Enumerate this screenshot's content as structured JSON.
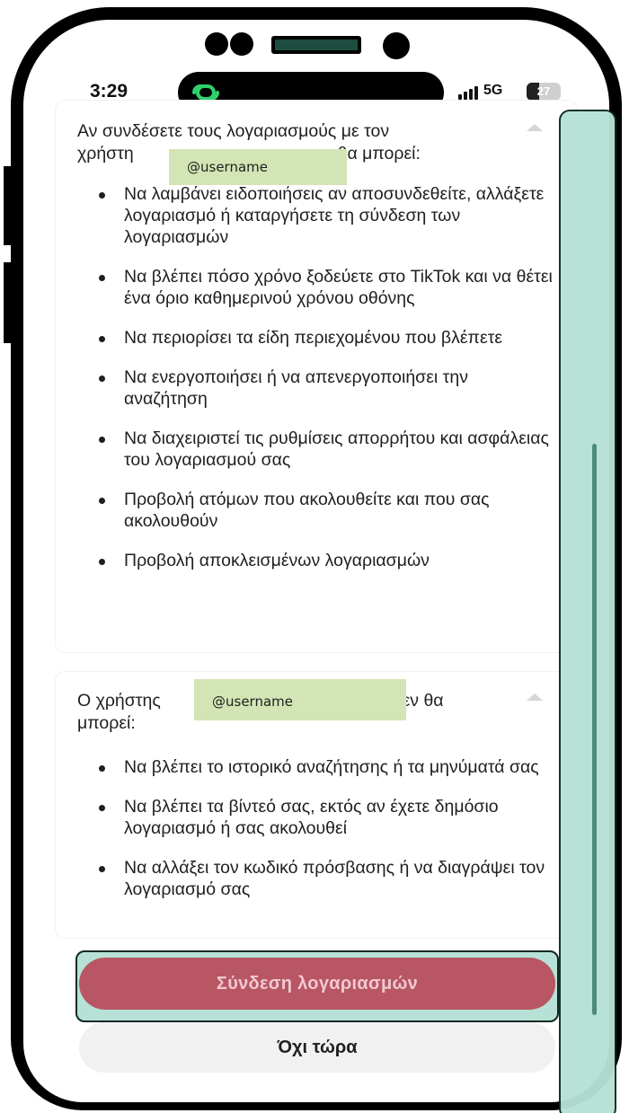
{
  "status_bar": {
    "time": "3:29",
    "network": "5G",
    "battery": "27",
    "app_icon": "link-logo-icon"
  },
  "card_permissions": {
    "intro_before": "Αν συνδέσετε τους λογαριασμούς με τον",
    "intro_line2_start": "χρήστη",
    "intro_line2_end": ", θα μπορεί:",
    "username_label": "@username",
    "items": [
      "Να λαμβάνει ειδοποιήσεις αν αποσυνδεθείτε, αλλάξετε λογαριασμό ή καταργήσετε τη σύνδεση των λογαριασμών",
      "Να βλέπει πόσο χρόνο ξοδεύετε στο TikTok και να θέτει ένα όριο καθημερινού χρόνου οθόνης",
      "Να περιορίσει τα είδη περιεχομένου που βλέπετε",
      "Να ενεργοποιήσει ή να απενεργοποιήσει την αναζήτηση",
      "Να διαχειριστεί τις ρυθμίσεις απορρήτου και ασφάλειας του λογαριασμού σας",
      "Προβολή ατόμων που ακολουθείτε και που σας ακολουθούν",
      "Προβολή αποκλεισμένων λογαριασμών"
    ]
  },
  "card_restrictions": {
    "intro_start": "Ο χρήστης",
    "intro_end": "δεν θα",
    "intro_line2": "μπορεί:",
    "username_label": "@username",
    "items": [
      "Να βλέπει το ιστορικό αναζήτησης ή τα μηνύματά σας",
      "Να βλέπει τα βίντεό σας, εκτός αν έχετε δημόσιο λογαριασμό ή σας ακολουθεί",
      "Να αλλάξει τον κωδικό πρόσβασης ή να διαγράψει τον λογαριασμό σας"
    ]
  },
  "actions": {
    "connect_label": "Σύνδεση λογαριασμών",
    "not_now_label": "Όχι τώρα"
  },
  "colors": {
    "accent": "#b85664",
    "highlight": "#b7e1d6",
    "redaction": "#d3e5b4"
  }
}
